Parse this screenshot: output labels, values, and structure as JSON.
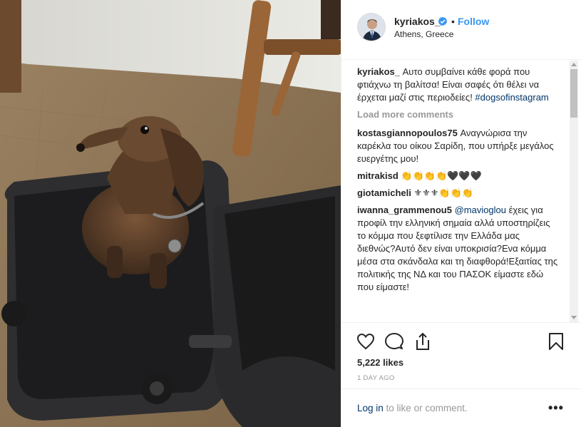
{
  "post": {
    "username": "kyriakos_",
    "separator": "•",
    "follow_label": "Follow",
    "location": "Athens, Greece"
  },
  "caption": {
    "username": "kyriakos_",
    "text": " Αυτο συμβαίνει κάθε φορά που φτιάχνω τη βαλίτσα! Είναι σαφές ότι θέλει να έρχεται μαζί στις περιοδείες! ",
    "hashtag": "#dogsofinstagram"
  },
  "load_more_label": "Load more comments",
  "comments": [
    {
      "username": "kostasgiannopoulos75",
      "text": " Αναγνώρισα την καρέκλα του οίκου Σαρίδη, που υπήρξε μεγάλος ευεργέτης μου!"
    },
    {
      "username": "mitrakisd",
      "text": " 👏👏👏👏🖤🖤🖤"
    },
    {
      "username": "giotamicheli",
      "text": " ⚜⚜⚜👏👏👏"
    },
    {
      "username": "iwanna_grammenou5",
      "mention": "@mavioglou",
      "text": " έχεις για προφίλ την ελληνική σημαία αλλά υποστηρίζεις το κόμμα που ξεφτίλισε την Ελλάδα μας διεθνώς?Αυτό δεν είναι υποκρισία?Ενα κόμμα μέσα στα σκάνδαλα και τη διαφθορά!Εξαιτίας της πολιτικής της ΝΔ και του ΠΑΣΟΚ είμαστε εδώ που είμαστε!"
    }
  ],
  "likes": "5,222 likes",
  "time": "1 DAY AGO",
  "footer": {
    "login_label": "Log in",
    "rest_label": " to like or comment.",
    "more_label": "•••"
  },
  "icons": {
    "like": "heart-icon",
    "comment": "comment-icon",
    "share": "share-icon",
    "save": "bookmark-icon",
    "verified": "verified-badge-icon"
  },
  "colors": {
    "link": "#3897f0",
    "dark_link": "#003569",
    "muted": "#999999",
    "text": "#262626"
  }
}
